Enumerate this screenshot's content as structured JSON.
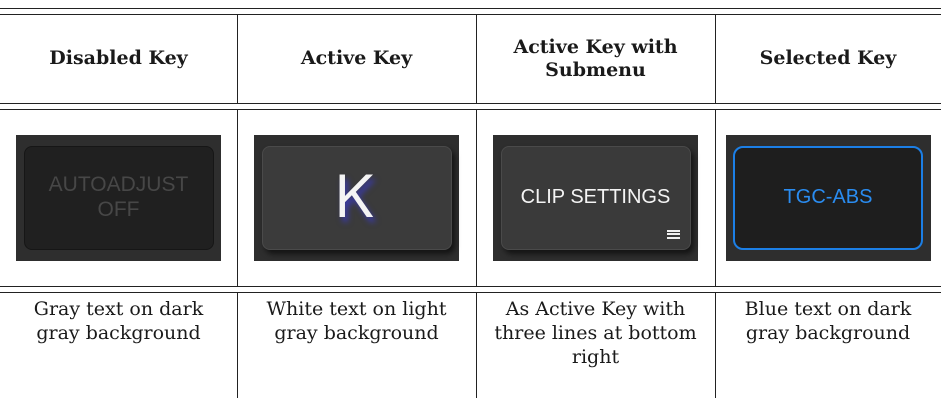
{
  "columns": [
    {
      "header": "Disabled Key",
      "key_label": "AUTOADJUST OFF",
      "description": "Gray text on dark gray background"
    },
    {
      "header": "Active Key",
      "key_label": "Ꮶ",
      "description": "White text on light gray background"
    },
    {
      "header": "Active Key with Submenu",
      "key_label": "CLIP SETTINGS",
      "description": "As Active Key with three lines at bottom right"
    },
    {
      "header": "Selected Key",
      "key_label": "TGC-ABS",
      "description": "Blue text on dark gray background"
    }
  ],
  "colors": {
    "disabled_text": "#474747",
    "active_text": "#f4f4f4",
    "selected_text": "#2a8cf0",
    "selected_border": "#1c7fe6",
    "screen_background": "#2e2e2e"
  },
  "icons": {
    "active_key_icon": "freeze-symbol-icon",
    "submenu_icon": "three-lines-menu-icon"
  }
}
